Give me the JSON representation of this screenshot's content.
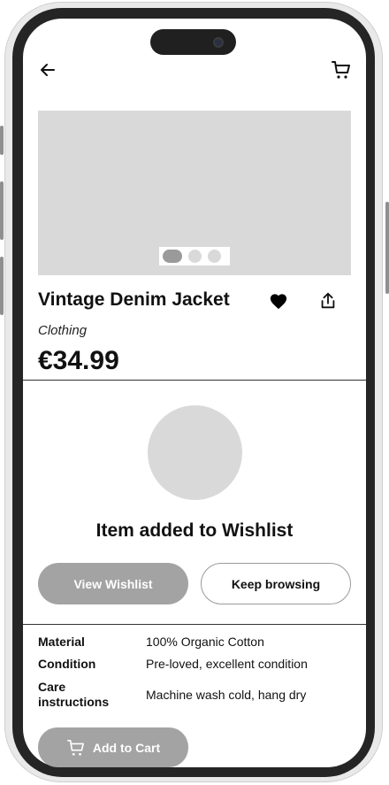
{
  "header": {
    "back_icon": "arrow-left-icon",
    "cart_icon": "shopping-cart-icon"
  },
  "product": {
    "title": "Vintage Denim Jacket",
    "category": "Clothing",
    "price": "€34.99",
    "carousel": {
      "total": 3,
      "active": 1
    },
    "favorite_icon": "heart-icon",
    "share_icon": "share-icon"
  },
  "wishlist_modal": {
    "title": "Item added to Wishlist",
    "view_label": "View Wishlist",
    "keep_label": "Keep browsing"
  },
  "details": [
    {
      "label": "Material",
      "value": "100% Organic Cotton"
    },
    {
      "label": "Condition",
      "value": "Pre-loved, excellent condition"
    },
    {
      "label": "Care instructions",
      "value": "Machine wash cold, hang dry"
    }
  ],
  "actions": {
    "add_to_cart_label": "Add to Cart"
  },
  "colors": {
    "placeholder": "#d9d9d9",
    "button_gray": "#a3a3a3",
    "frame": "#252525"
  }
}
